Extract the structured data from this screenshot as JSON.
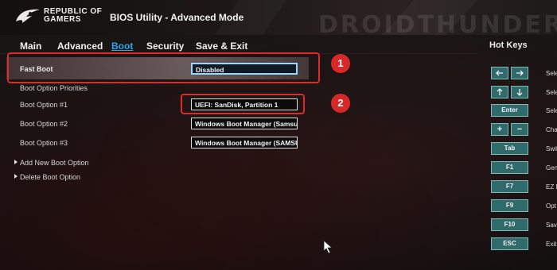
{
  "header": {
    "brand": "REPUBLIC OF GAMERS",
    "title": "BIOS Utility - Advanced Mode",
    "watermark": "DROIDTHUNDER"
  },
  "tabs": [
    {
      "label": "Main",
      "active": false
    },
    {
      "label": "Advanced",
      "active": false
    },
    {
      "label": "Boot",
      "active": true
    },
    {
      "label": "Security",
      "active": false
    },
    {
      "label": "Save & Exit",
      "active": false
    }
  ],
  "settings": {
    "fast_boot": {
      "label": "Fast Boot",
      "value": "Disabled"
    },
    "priorities_heading": "Boot Option Priorities",
    "boot_options": [
      {
        "label": "Boot Option #1",
        "value": "UEFI: SanDisk, Partition 1"
      },
      {
        "label": "Boot Option #2",
        "value": "Windows Boot Manager (Samsun"
      },
      {
        "label": "Boot Option #3",
        "value": "Windows Boot Manager (SAMSUN"
      }
    ],
    "actions": [
      {
        "label": "Add New Boot Option"
      },
      {
        "label": "Delete Boot Option"
      }
    ]
  },
  "callouts": [
    "1",
    "2"
  ],
  "hotkeys": {
    "title": "Hot Keys",
    "keys": [
      {
        "keys": [
          "left-arrow-icon",
          "right-arrow-icon"
        ],
        "desc": "Sele"
      },
      {
        "keys": [
          "up-arrow-icon",
          "down-arrow-icon"
        ],
        "desc": "Sele"
      },
      {
        "label": "Enter",
        "desc": "Sele"
      },
      {
        "keys": [
          "+",
          "−"
        ],
        "desc": "Cha"
      },
      {
        "label": "Tab",
        "desc": "Swit"
      },
      {
        "label": "F1",
        "desc": "Gen"
      },
      {
        "label": "F7",
        "desc": "EZ M"
      },
      {
        "label": "F9",
        "desc": "Opt"
      },
      {
        "label": "F10",
        "desc": "Save"
      },
      {
        "label": "ESC",
        "desc": "Exit"
      }
    ]
  },
  "colors": {
    "accent": "#2ea4e8",
    "callout": "#d72828",
    "hotkey_bg": "#2f6b6b"
  }
}
